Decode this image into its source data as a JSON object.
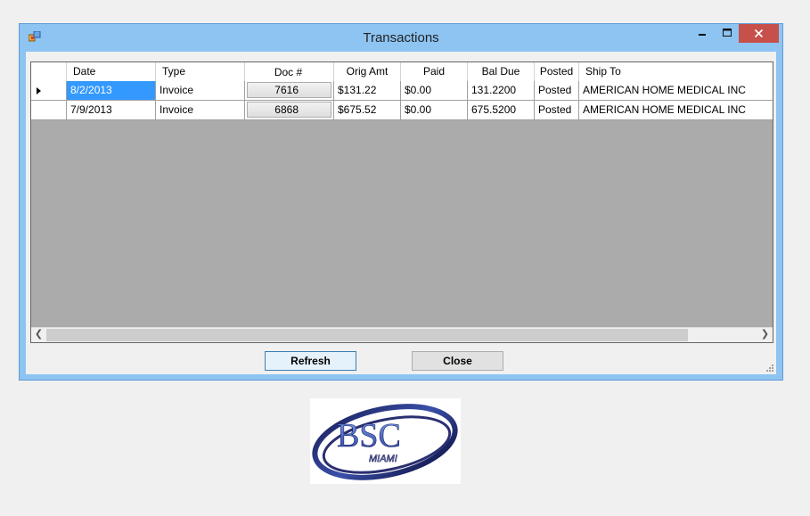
{
  "window": {
    "title": "Transactions"
  },
  "grid": {
    "columns": [
      "Date",
      "Type",
      "Doc #",
      "Orig Amt",
      "Paid",
      "Bal Due",
      "Posted",
      "Ship To"
    ],
    "rows": [
      {
        "date": "8/2/2013",
        "type": "Invoice",
        "doc": "7616",
        "orig": "$131.22",
        "paid": "$0.00",
        "bal": "131.2200",
        "posted": "Posted",
        "ship": "AMERICAN HOME MEDICAL INC"
      },
      {
        "date": "7/9/2013",
        "type": "Invoice",
        "doc": "6868",
        "orig": "$675.52",
        "paid": "$0.00",
        "bal": "675.5200",
        "posted": "Posted",
        "ship": "AMERICAN HOME MEDICAL INC"
      }
    ]
  },
  "buttons": {
    "refresh": "Refresh",
    "close": "Close"
  },
  "logo": {
    "text": "BSC",
    "subtext": "MIAMI"
  },
  "colors": {
    "titlebar": "#8dc4f2",
    "close_button": "#c7504a",
    "selection": "#3399ff",
    "grid_background": "#ababab",
    "logo_blue": "#3a4fa8"
  }
}
